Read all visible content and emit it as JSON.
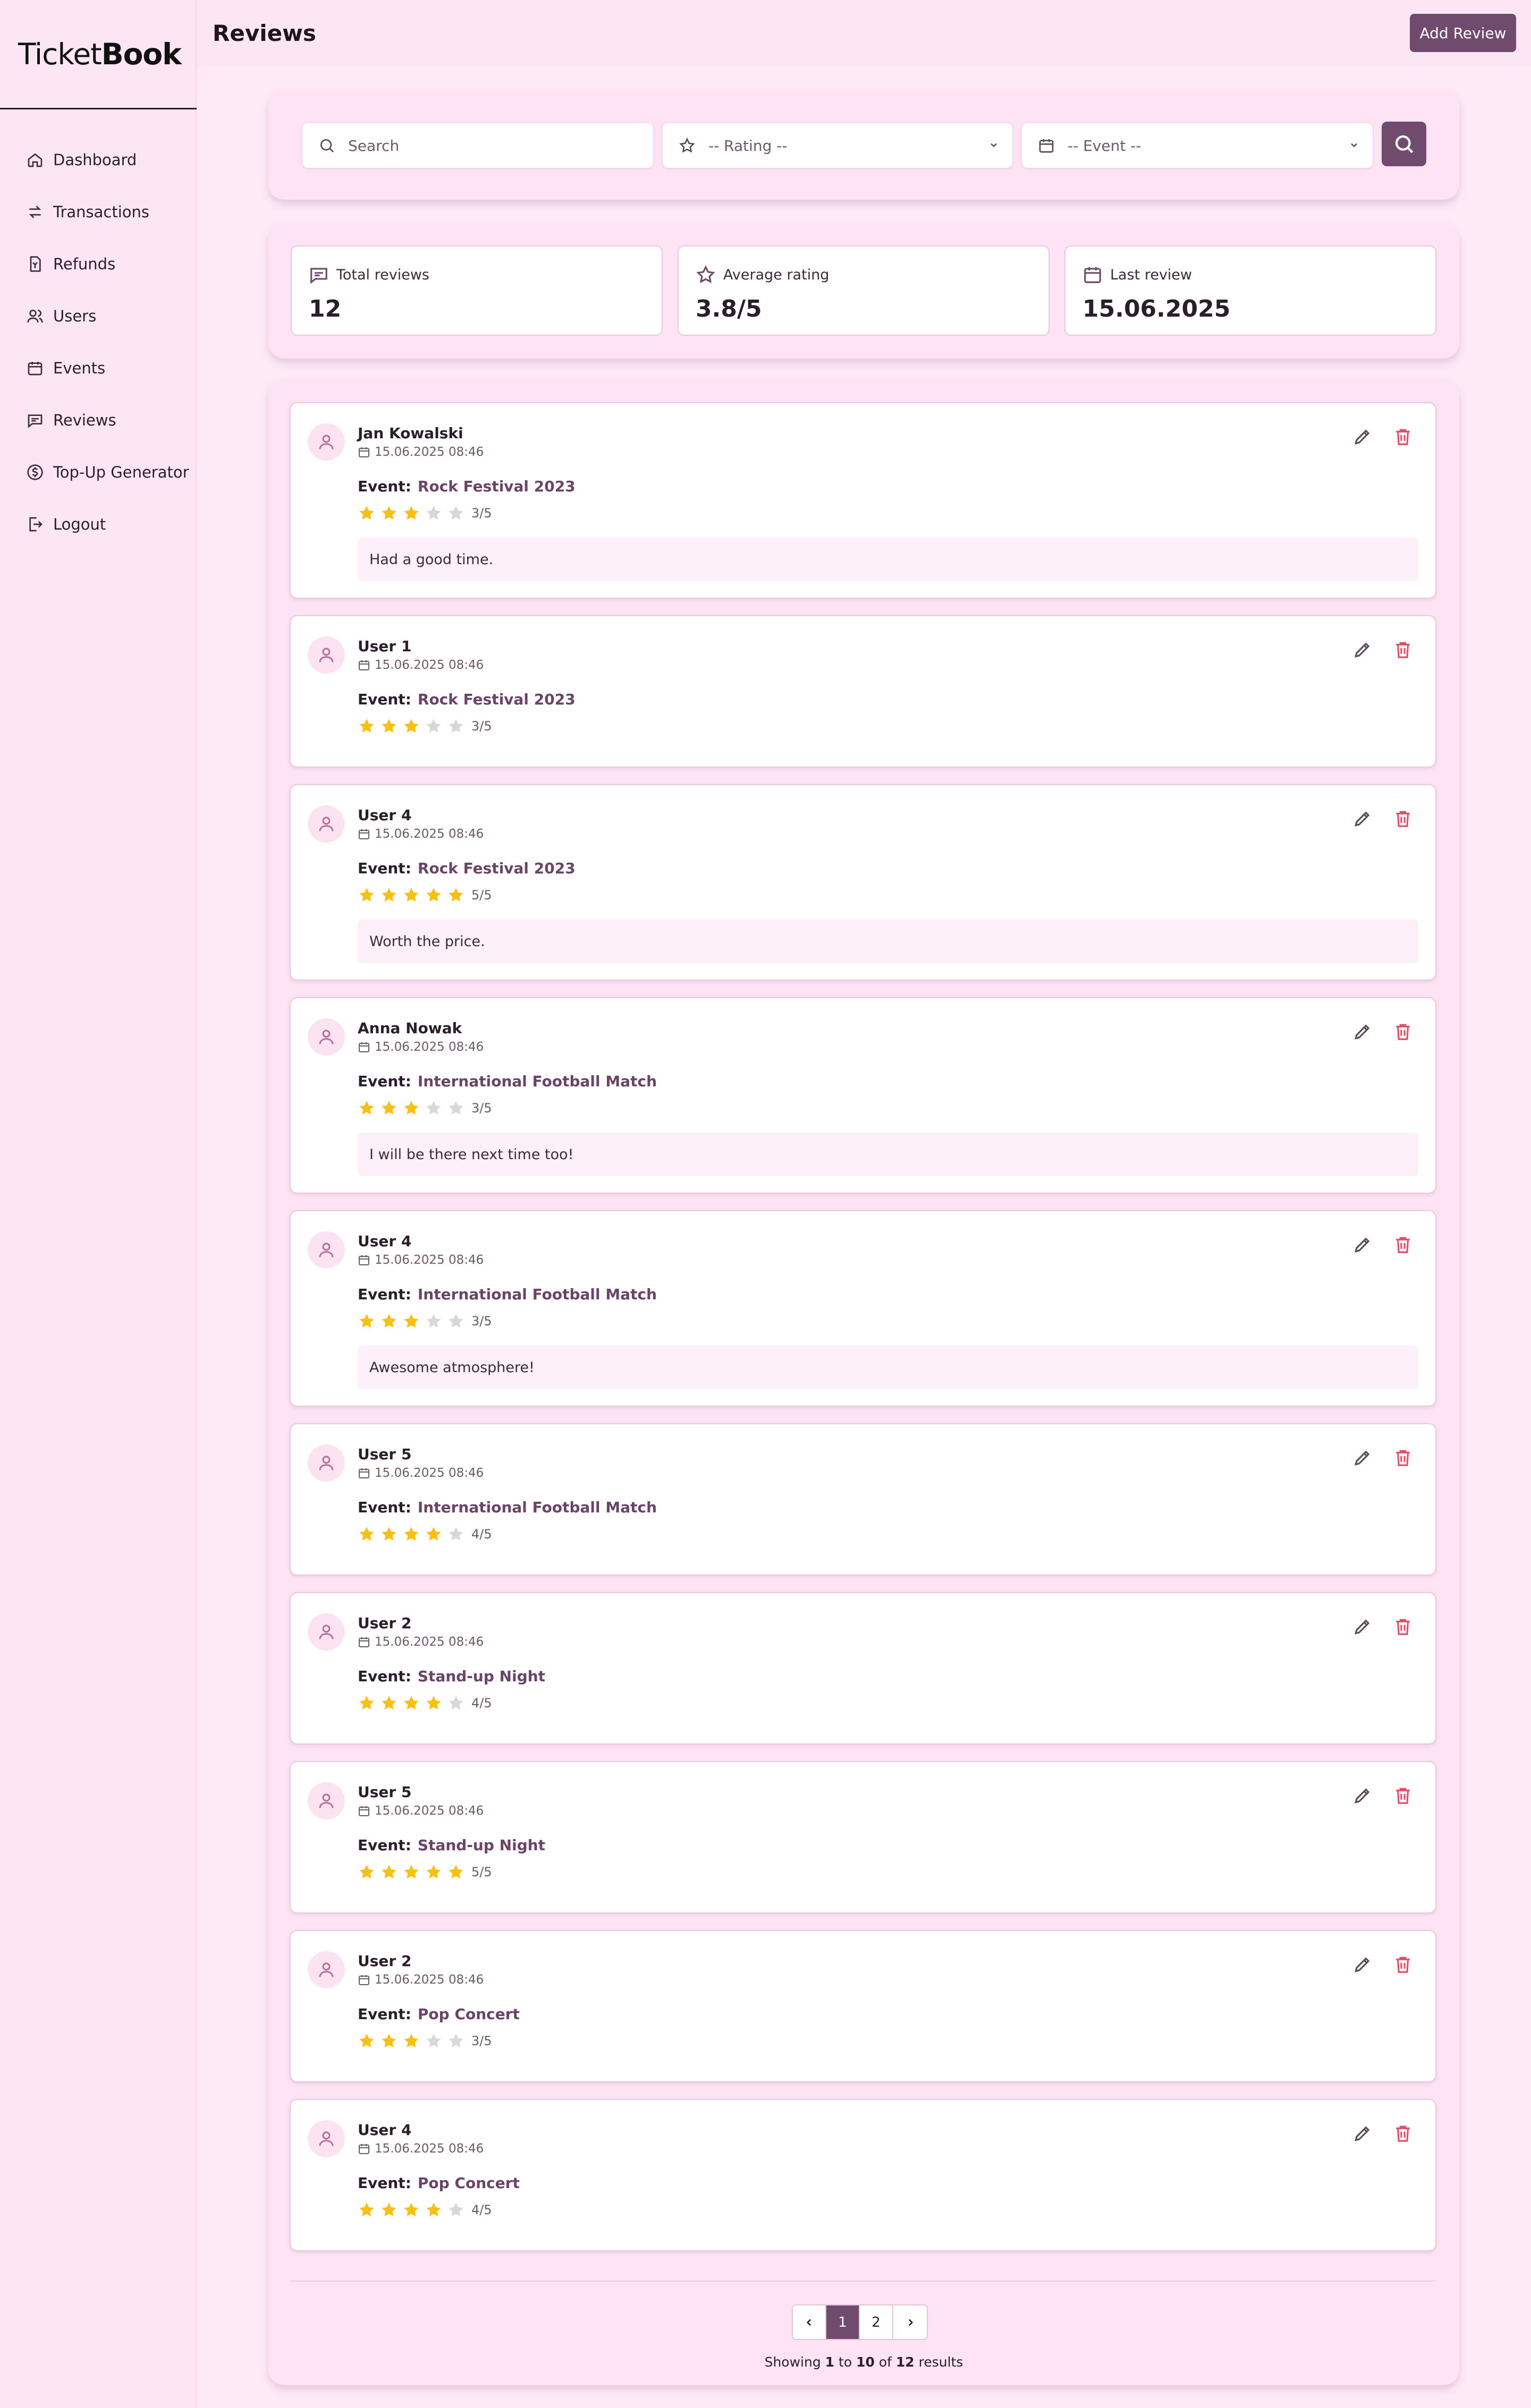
{
  "app": {
    "logo_light": "Ticket",
    "logo_bold": "Book"
  },
  "sidebar": {
    "items": [
      {
        "label": "Dashboard",
        "icon": "home-icon"
      },
      {
        "label": "Transactions",
        "icon": "arrows-icon"
      },
      {
        "label": "Refunds",
        "icon": "receipt-icon"
      },
      {
        "label": "Users",
        "icon": "users-icon"
      },
      {
        "label": "Events",
        "icon": "calendar-icon"
      },
      {
        "label": "Reviews",
        "icon": "message-icon"
      },
      {
        "label": "Top-Up Generator",
        "icon": "dollar-icon"
      },
      {
        "label": "Logout",
        "icon": "logout-icon"
      }
    ]
  },
  "header": {
    "title": "Reviews",
    "add_button": "Add Review"
  },
  "filters": {
    "search_placeholder": "Search",
    "rating_selected": "-- Rating --",
    "event_selected": "-- Event --"
  },
  "stats": {
    "total_label": "Total reviews",
    "total_value": "12",
    "avg_label": "Average rating",
    "avg_value": "3.8/5",
    "last_label": "Last review",
    "last_value": "15.06.2025"
  },
  "event_prefix": "Event:",
  "reviews": [
    {
      "user": "Jan Kowalski",
      "date": "15.06.2025 08:46",
      "event": "Rock Festival 2023",
      "rating": 3,
      "rating_text": "3/5",
      "comment": "Had a good time."
    },
    {
      "user": "User 1",
      "date": "15.06.2025 08:46",
      "event": "Rock Festival 2023",
      "rating": 3,
      "rating_text": "3/5",
      "comment": ""
    },
    {
      "user": "User 4",
      "date": "15.06.2025 08:46",
      "event": "Rock Festival 2023",
      "rating": 5,
      "rating_text": "5/5",
      "comment": "Worth the price."
    },
    {
      "user": "Anna Nowak",
      "date": "15.06.2025 08:46",
      "event": "International Football Match",
      "rating": 3,
      "rating_text": "3/5",
      "comment": "I will be there next time too!"
    },
    {
      "user": "User 4",
      "date": "15.06.2025 08:46",
      "event": "International Football Match",
      "rating": 3,
      "rating_text": "3/5",
      "comment": "Awesome atmosphere!"
    },
    {
      "user": "User 5",
      "date": "15.06.2025 08:46",
      "event": "International Football Match",
      "rating": 4,
      "rating_text": "4/5",
      "comment": ""
    },
    {
      "user": "User 2",
      "date": "15.06.2025 08:46",
      "event": "Stand-up Night",
      "rating": 4,
      "rating_text": "4/5",
      "comment": ""
    },
    {
      "user": "User 5",
      "date": "15.06.2025 08:46",
      "event": "Stand-up Night",
      "rating": 5,
      "rating_text": "5/5",
      "comment": ""
    },
    {
      "user": "User 2",
      "date": "15.06.2025 08:46",
      "event": "Pop Concert",
      "rating": 3,
      "rating_text": "3/5",
      "comment": ""
    },
    {
      "user": "User 4",
      "date": "15.06.2025 08:46",
      "event": "Pop Concert",
      "rating": 4,
      "rating_text": "4/5",
      "comment": ""
    }
  ],
  "pagination": {
    "pages": [
      "1",
      "2"
    ],
    "active": "1",
    "showing": "Showing",
    "from": "1",
    "to_word": "to",
    "to": "10",
    "of_word": "of",
    "total": "12",
    "results_word": "results"
  },
  "colors": {
    "accent": "#704b6e",
    "star_on": "#f7c013",
    "star_off": "#d9d6dc",
    "danger": "#e0506a"
  }
}
